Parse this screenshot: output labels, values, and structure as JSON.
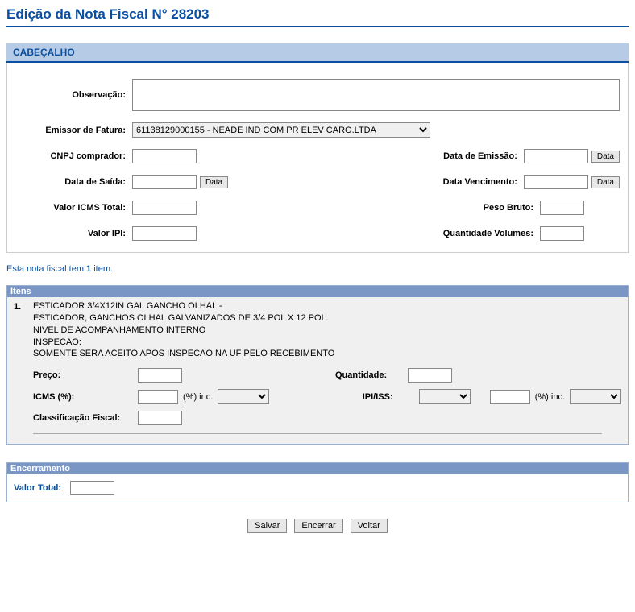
{
  "title": "Edição da Nota Fiscal N° 28203",
  "section_cabecalho": "CABEÇALHO",
  "labels": {
    "observacao": "Observação:",
    "emissor": "Emissor de Fatura:",
    "cnpj_comprador": "CNPJ comprador:",
    "data_emissao": "Data de Emissão:",
    "data_saida": "Data de Saída:",
    "data_vencimento": "Data Vencimento:",
    "valor_icms_total": "Valor ICMS Total:",
    "peso_bruto": "Peso Bruto:",
    "valor_ipi": "Valor IPI:",
    "qtd_volumes": "Quantidade Volumes:"
  },
  "buttons": {
    "data": "Data",
    "salvar": "Salvar",
    "encerrar": "Encerrar",
    "voltar": "Voltar"
  },
  "emissor_options": [
    "61138129000155 - NEADE IND COM PR ELEV CARG.LTDA"
  ],
  "emissor_selected": "61138129000155 - NEADE IND COM PR ELEV CARG.LTDA",
  "values": {
    "observacao": "",
    "cnpj_comprador": "",
    "data_emissao": "",
    "data_saida": "",
    "data_vencimento": "",
    "valor_icms_total": "",
    "peso_bruto": "",
    "valor_ipi": "",
    "qtd_volumes": ""
  },
  "info_line_prefix": "Esta nota fiscal tem ",
  "info_line_count": "1",
  "info_line_suffix": " item.",
  "itens_header": "Itens",
  "item": {
    "num": "1.",
    "desc_line1": "ESTICADOR 3/4X12IN GAL GANCHO OLHAL  -",
    "desc_line2": "ESTICADOR, GANCHOS OLHAL GALVANIZADOS DE 3/4 POL X 12 POL.",
    "desc_line3": "NIVEL DE ACOMPANHAMENTO INTERNO",
    "desc_line4": "INSPECAO:",
    "desc_line5": "SOMENTE SERA ACEITO APOS INSPECAO NA UF PELO RECEBIMENTO",
    "labels": {
      "preco": "Preço:",
      "quantidade": "Quantidade:",
      "icms": "ICMS (%):",
      "pct_inc": "(%) inc.",
      "ipi_iss": "IPI/ISS:",
      "classificacao": "Classificação Fiscal:"
    },
    "values": {
      "preco": "",
      "quantidade": "",
      "icms": "",
      "icms_inc": "",
      "ipi_iss_sel": "",
      "ipi_iss_val": "",
      "ipi_iss_inc": "",
      "classificacao": ""
    }
  },
  "encerramento_header": "Encerramento",
  "encerramento": {
    "valor_total_label": "Valor Total:",
    "valor_total": ""
  }
}
